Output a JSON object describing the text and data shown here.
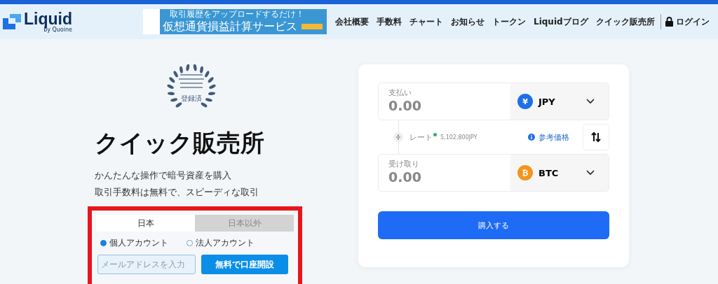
{
  "header": {
    "logo": {
      "name": "Liquid",
      "byline": "by Quoine"
    },
    "banner": {
      "tagline": "取引履歴をアップロードするだけ！",
      "title": "仮想通貨損益計算サービス"
    },
    "nav": [
      "会社概要",
      "手数料",
      "チャート",
      "お知らせ",
      "トークン",
      "Liquidブログ",
      "クイック販売所"
    ],
    "login": "ログイン"
  },
  "hero": {
    "seal": "登録済",
    "title": "クイック販売所",
    "lines": [
      "かんたんな操作で暗号資産を購入",
      "取引手数料は無料で、スピーディな取引"
    ]
  },
  "signup": {
    "tabs": [
      {
        "label": "日本",
        "selected": true
      },
      {
        "label": "日本以外",
        "selected": false
      }
    ],
    "account_types": [
      {
        "label": "個人アカウント",
        "selected": true
      },
      {
        "label": "法人アカウント",
        "selected": false
      }
    ],
    "email": {
      "placeholder": "メールアドレスを入力"
    },
    "button": "無料で口座開設"
  },
  "trade": {
    "pay": {
      "label": "支払い",
      "value": "0.00",
      "currency": "JPY",
      "symbol": "¥",
      "kind": "fiat"
    },
    "rate": {
      "label": "レート",
      "value": "5,102,800JPY",
      "reference": "参考価格"
    },
    "receive": {
      "label": "受け取り",
      "value": "0.00",
      "currency": "BTC",
      "symbol": "₿",
      "kind": "crypto"
    },
    "button": "購入する"
  }
}
